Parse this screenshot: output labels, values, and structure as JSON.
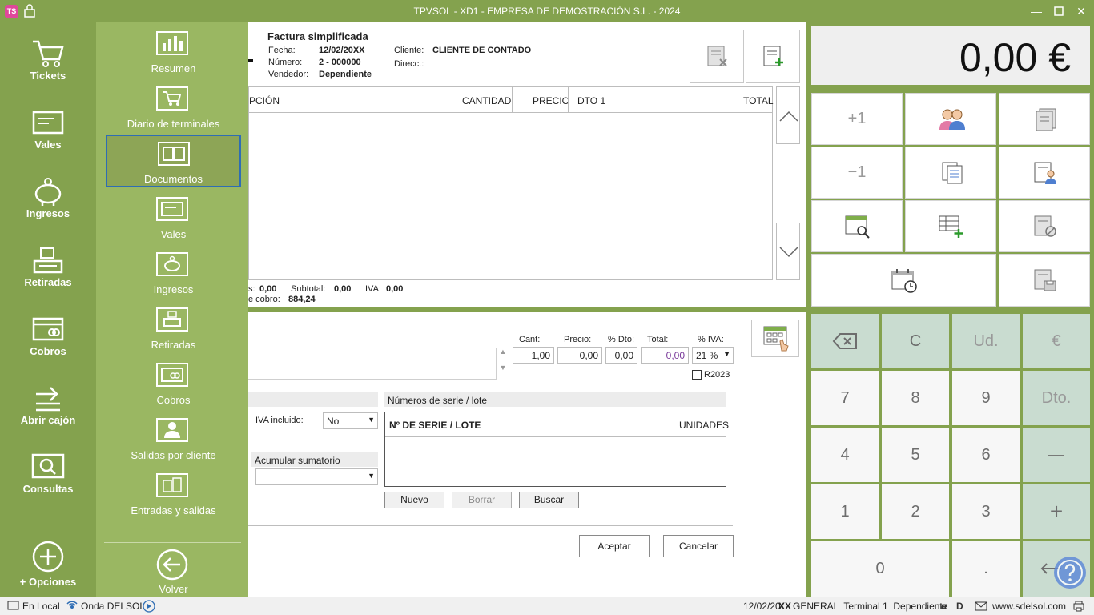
{
  "window": {
    "title": "TPVSOL - XD1 - EMPRESA DE DEMOSTRACIÓN S.L. - 2024",
    "logo": "TS"
  },
  "leftnav": [
    {
      "label": "Tickets",
      "icon": "cart-icon"
    },
    {
      "label": "Vales",
      "icon": "voucher-icon"
    },
    {
      "label": "Ingresos",
      "icon": "piggy-bank-icon"
    },
    {
      "label": "Retiradas",
      "icon": "cash-register-icon"
    },
    {
      "label": "Cobros",
      "icon": "card-icon"
    },
    {
      "label": "Abrir cajón",
      "icon": "open-drawer-icon"
    },
    {
      "label": "Consultas",
      "icon": "search-icon"
    },
    {
      "label": "+ Opciones",
      "icon": "plus-circle-icon"
    }
  ],
  "submenu": [
    {
      "label": "Resumen",
      "icon": "bar-chart-icon"
    },
    {
      "label": "Diario de terminales",
      "icon": "cart-icon"
    },
    {
      "label": "Documentos",
      "icon": "book-icon",
      "selected": true
    },
    {
      "label": "Vales",
      "icon": "voucher-icon"
    },
    {
      "label": "Ingresos",
      "icon": "piggy-bank-icon"
    },
    {
      "label": "Retiradas",
      "icon": "cash-register-icon"
    },
    {
      "label": "Cobros",
      "icon": "card-icon"
    },
    {
      "label": "Salidas por cliente",
      "icon": "user-icon"
    },
    {
      "label": "Entradas y salidas",
      "icon": "boxes-icon"
    },
    {
      "label": "Volver",
      "icon": "back-arrow-icon"
    }
  ],
  "invoice": {
    "title": "Factura simplificada",
    "fecha_label": "Fecha:",
    "fecha": "12/02/20XX",
    "numero_label": "Número:",
    "numero": "2 - 000000",
    "vendedor_label": "Vendedor:",
    "vendedor": "Dependiente",
    "cliente_label": "Cliente:",
    "cliente": "CLIENTE DE CONTADO",
    "direcc_label": "Direcc.:"
  },
  "grid": {
    "columns": [
      "PCIÓN",
      "CANTIDAD",
      "PRECIO",
      "DTO 1",
      "TOTAL"
    ]
  },
  "totals": {
    "lineas_label": "s:",
    "lineas": "0,00",
    "subtotal_label": "Subtotal:",
    "subtotal": "0,00",
    "iva_label": "IVA:",
    "iva": "0,00",
    "cobro_label": "e cobro:",
    "cobro": "884,24"
  },
  "line": {
    "cant_label": "Cant:",
    "cant": "1,00",
    "precio_label": "Precio:",
    "precio": "0,00",
    "dto_label": "% Dto:",
    "dto": "0,00",
    "total_label": "Total:",
    "total": "0,00",
    "iva_label": "% IVA:",
    "iva": "21 %",
    "r2023": "R2023"
  },
  "options": {
    "iva_incluido_label": "IVA incluido:",
    "iva_incluido": "No",
    "acumular_label": "Acumular sumatorio",
    "acumular": ""
  },
  "serial": {
    "header": "Números de serie / lote",
    "col1": "Nº DE SERIE / LOTE",
    "col2": "UNIDADES",
    "nuevo": "Nuevo",
    "borrar": "Borrar",
    "buscar": "Buscar"
  },
  "actions": {
    "aceptar": "Aceptar",
    "cancelar": "Cancelar"
  },
  "display": {
    "amount": "0,00 €"
  },
  "funcs": {
    "plus1": "+1",
    "minus1": "−1"
  },
  "keypad": [
    "C",
    "Ud.",
    "€",
    "7",
    "8",
    "9",
    "Dto.",
    "4",
    "5",
    "6",
    "—",
    "1",
    "2",
    "3",
    "+",
    "0",
    "."
  ],
  "status": {
    "local": "En Local",
    "onda": "Onda DELSOL",
    "date": "12/02/20",
    "date_bold": "XX",
    "info": "GENERAL  Terminal 1  Dependiente",
    "web": "www.sdelsol.com"
  }
}
